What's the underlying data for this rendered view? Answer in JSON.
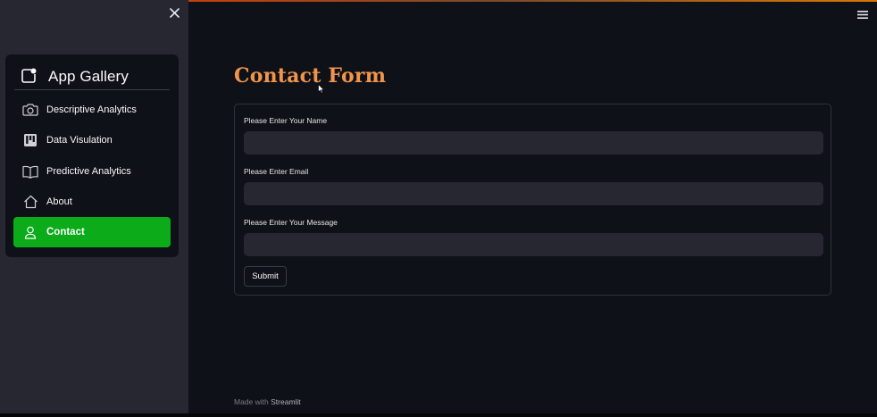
{
  "sidebar": {
    "title": "App Gallery",
    "title_icon": "app-gallery-icon",
    "close_icon": "close-icon",
    "items": [
      {
        "label": "Descriptive Analytics",
        "icon": "camera-icon",
        "active": false
      },
      {
        "label": "Data Visulation",
        "icon": "kanban-icon",
        "active": false
      },
      {
        "label": "Predictive Analytics",
        "icon": "book-icon",
        "active": false
      },
      {
        "label": "About",
        "icon": "house-icon",
        "active": false
      },
      {
        "label": "Contact",
        "icon": "person-icon",
        "active": true
      }
    ],
    "active_color": "#0bab1a"
  },
  "header": {
    "menu_icon": "hamburger-menu-icon"
  },
  "main": {
    "title": "Contact Form",
    "title_color": "#f0954a",
    "form": {
      "fields": [
        {
          "label": "Please Enter Your Name",
          "value": "",
          "placeholder": ""
        },
        {
          "label": "Please Enter Email",
          "value": "",
          "placeholder": ""
        },
        {
          "label": "Please Enter Your Message",
          "value": "",
          "placeholder": ""
        }
      ],
      "submit_label": "Submit"
    }
  },
  "footer": {
    "prefix": "Made with",
    "brand": "Streamlit"
  },
  "colors": {
    "background": "#0e1117",
    "sidebar": "#262730",
    "input": "#262730"
  }
}
